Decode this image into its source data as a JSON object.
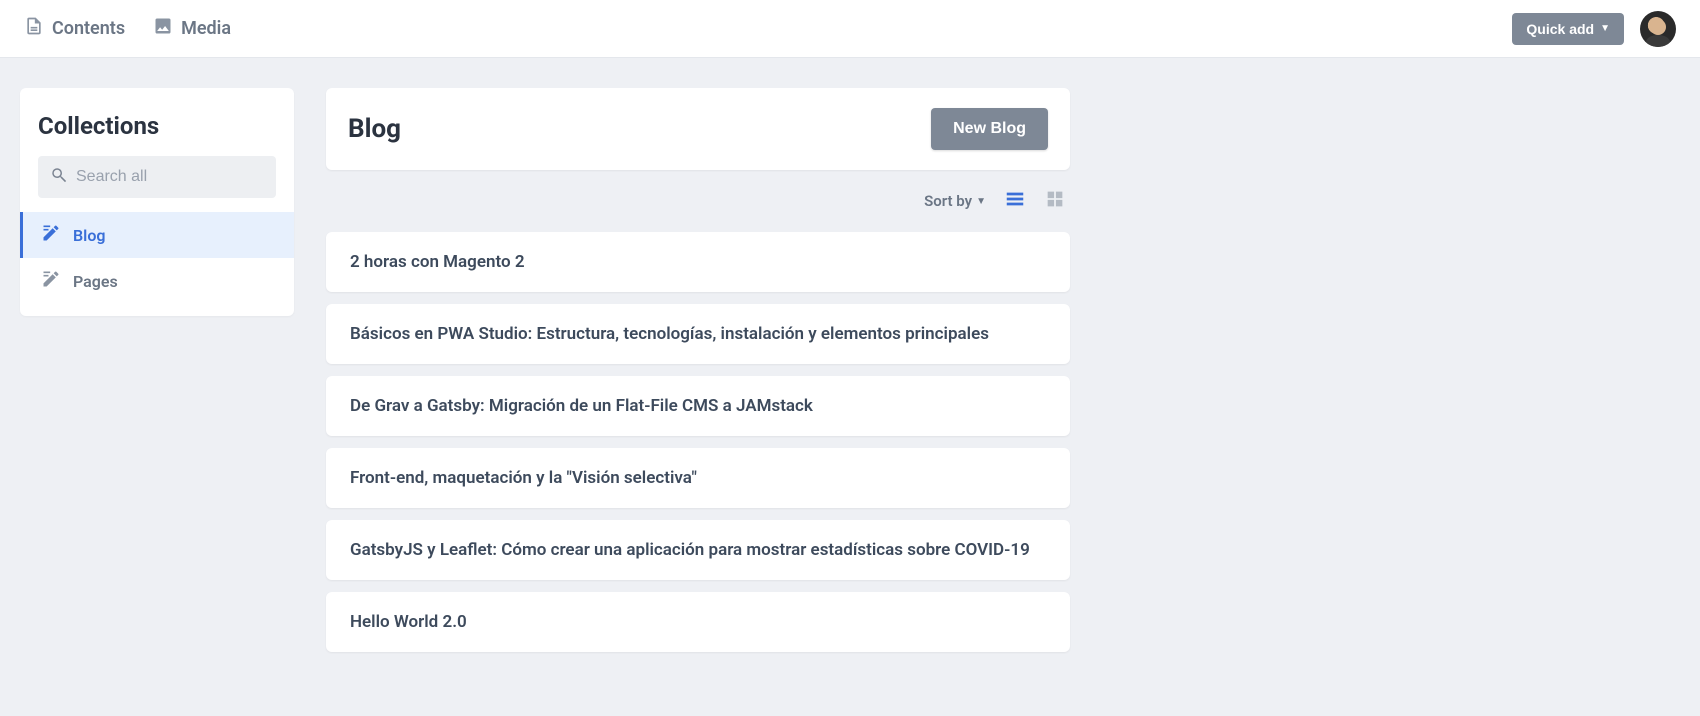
{
  "topbar": {
    "nav": [
      {
        "id": "contents",
        "label": "Contents"
      },
      {
        "id": "media",
        "label": "Media"
      }
    ],
    "quick_add_label": "Quick add"
  },
  "sidebar": {
    "title": "Collections",
    "search_placeholder": "Search all",
    "items": [
      {
        "id": "blog",
        "label": "Blog",
        "active": true
      },
      {
        "id": "pages",
        "label": "Pages",
        "active": false
      }
    ]
  },
  "content": {
    "title": "Blog",
    "new_button_label": "New Blog",
    "sort_label": "Sort by",
    "entries": [
      {
        "title": "2 horas con Magento 2"
      },
      {
        "title": "Básicos en PWA Studio: Estructura, tecnologías, instalación y elementos principales"
      },
      {
        "title": "De Grav a Gatsby: Migración de un Flat-File CMS a JAMstack"
      },
      {
        "title": "Front-end, maquetación y la \"Visión selectiva\""
      },
      {
        "title": "GatsbyJS y Leaflet: Cómo crear una aplicación para mostrar estadísticas sobre COVID-19"
      },
      {
        "title": "Hello World 2.0"
      }
    ]
  }
}
